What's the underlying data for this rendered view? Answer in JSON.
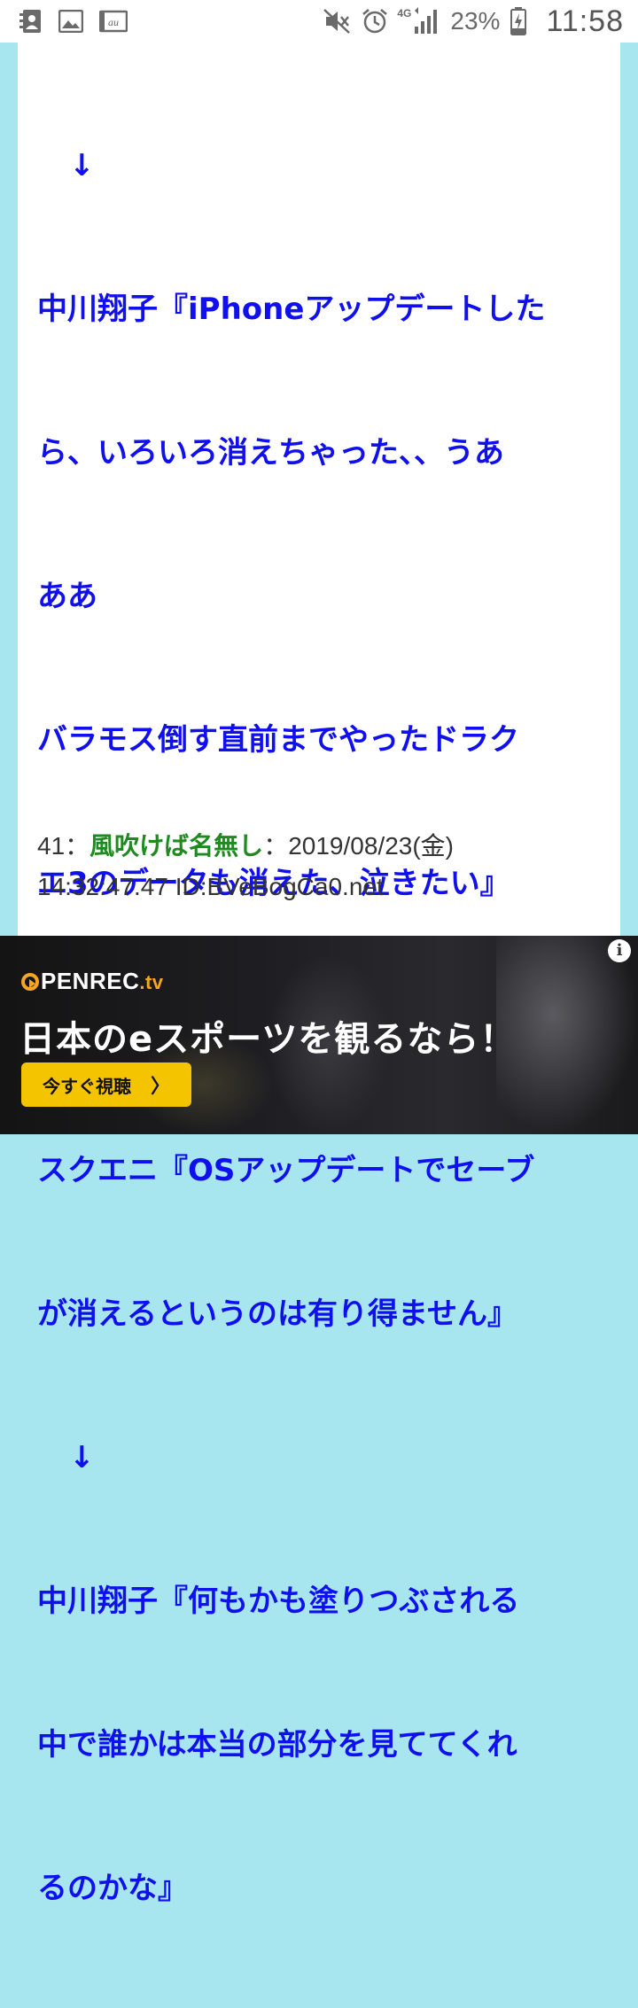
{
  "status_bar": {
    "carrier_label": "au",
    "network": "4G",
    "battery": "23%",
    "time": "11:58"
  },
  "post_body": {
    "arrow_1": "↓",
    "line_1": "中川翔子『iPhoneアップデートした",
    "line_2": "ら、いろいろ消えちゃった、、うあ",
    "line_3": "ああ",
    "line_4": "バラモス倒す直前までやったドラク",
    "line_5": "エ3のデータも消えた、泣きたい』",
    "arrow_2": "↓",
    "line_6": "スクエニ『OSアップデートでセーブ",
    "line_7": "が消えるというのは有り得ません』",
    "arrow_3": "↓",
    "line_8": "中川翔子『何もかも塗りつぶされる",
    "line_9": "中で誰かは本当の部分を見ててくれ",
    "line_10": "るのかな』"
  },
  "post_meta": {
    "number": "41",
    "separator": "：",
    "name": "風吹けば名無し",
    "date": "2019/08/23(金)",
    "time_and_id": "14:32:47.47 ID:BVeBogCa0.net"
  },
  "ad": {
    "logo_text": "PENREC",
    "logo_suffix": ".tv",
    "headline": "日本のeスポーツを観るなら！",
    "cta_label": "今すぐ視聴",
    "cta_chevron": "〉",
    "info_label": "i"
  }
}
